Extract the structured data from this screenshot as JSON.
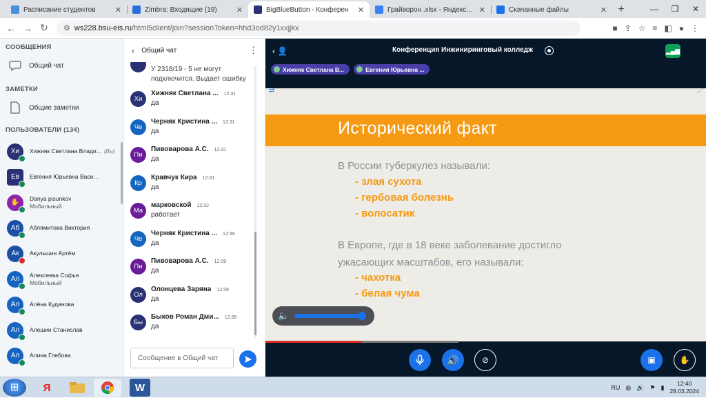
{
  "browser": {
    "tabs": [
      {
        "title": "Расписание студентов",
        "color": "#4a90d9"
      },
      {
        "title": "Zimbra: Входящие (19)",
        "color": "#2a6fdb"
      },
      {
        "title": "BigBlueButton - Конферен",
        "color": "#283274",
        "active": true
      },
      {
        "title": "Грайворон .xlsx - Яндекс Докум",
        "color": "#3b82f6"
      },
      {
        "title": "Скачанные файлы",
        "color": "#1a73e8"
      }
    ],
    "url_host": "ws228.bsu-eis.ru",
    "url_rest": "/html5client/join?sessionToken=hhd3od82y1xxjjkx"
  },
  "left": {
    "messages_header": "СООБЩЕНИЯ",
    "public_chat": "Общий чат",
    "notes_header": "ЗАМЕТКИ",
    "shared_notes": "Общие заметки",
    "users_header": "ПОЛЬЗОВАТЕЛИ (134)",
    "you_label": "(Вы)",
    "users": [
      {
        "initials": "Хи",
        "name": "Хижняк Светлана Влади...",
        "sub": "",
        "color": "#283274",
        "you": true
      },
      {
        "initials": "Ев",
        "name": "Евгения Юрьевна Васильева",
        "sub": "",
        "color": "#283274",
        "presenter": true
      },
      {
        "initials": "",
        "name": "Danya pisunkov",
        "sub": "Мобильный",
        "color": "#8e24aa",
        "hand": true
      },
      {
        "initials": "Аб",
        "name": "Аблямитова Виктория",
        "sub": "",
        "color": "#1b4fa8"
      },
      {
        "initials": "Ак",
        "name": "Акульшин Артём",
        "sub": "",
        "color": "#1b4fa8",
        "muted": true
      },
      {
        "initials": "Ал",
        "name": "Алексеева Софья",
        "sub": "Мобильный",
        "color": "#1565c0"
      },
      {
        "initials": "Ал",
        "name": "Алёна Кудинова",
        "sub": "",
        "color": "#1565c0"
      },
      {
        "initials": "Ал",
        "name": "Алешин Станислав",
        "sub": "",
        "color": "#1565c0"
      },
      {
        "initials": "Ал",
        "name": "Алина Глебова",
        "sub": "",
        "color": "#1565c0"
      }
    ]
  },
  "chat": {
    "title": "Общий чат",
    "first_lines": [
      "У 2318/19 - 5 не могут",
      "подключится. Выдает ошибку"
    ],
    "messages": [
      {
        "initials": "Хи",
        "name": "Хижняк Светлана ...",
        "time": "12:31",
        "text": "да",
        "color": "#283274"
      },
      {
        "initials": "Че",
        "name": "Черняк Кристина ...",
        "time": "12:31",
        "text": "да",
        "color": "#1565c0"
      },
      {
        "initials": "Пи",
        "name": "Пивоварова А.С.",
        "time": "12:31",
        "text": "да",
        "color": "#6a1b9a"
      },
      {
        "initials": "Кр",
        "name": "Кравчук Кира",
        "time": "12:31",
        "text": "да",
        "color": "#1565c0"
      },
      {
        "initials": "Ма",
        "name": "марковской",
        "time": "12:32",
        "text": "работает",
        "color": "#6a1b9a"
      },
      {
        "initials": "Че",
        "name": "Черняк Кристина ...",
        "time": "12:39",
        "text": "да",
        "color": "#1565c0"
      },
      {
        "initials": "Пи",
        "name": "Пивоварова А.С.",
        "time": "12:39",
        "text": "да",
        "color": "#6a1b9a"
      },
      {
        "initials": "Ол",
        "name": "Олонцева Заряна",
        "time": "12:39",
        "text": "да",
        "color": "#283274"
      },
      {
        "initials": "Бы",
        "name": "Быков Роман Дми...",
        "time": "12:39",
        "text": "да",
        "color": "#283274"
      }
    ],
    "placeholder": "Сообщение в Общий чат"
  },
  "pres": {
    "title": "Конференция Инжиниринговый колледж",
    "talkers": [
      "Хижняк Светлана В...",
      "Евгения Юрьевна ..."
    ],
    "slide_title": "Исторический факт",
    "line1": "В России туберкулез называли:",
    "bullets1": [
      "- злая сухота",
      "- гербовая болезнь",
      "- волосатик"
    ],
    "line2": "В Европе, где в 18 веке заболевание достигло",
    "line3": "ужасающих масштабов, его называли:",
    "bullets2": [
      "- чахотка",
      "- белая чума"
    ],
    "volume_level": 1.0,
    "progress_fraction": 0.5
  },
  "taskbar": {
    "lang": "RU",
    "time": "12:40",
    "date": "28.03.2024"
  }
}
